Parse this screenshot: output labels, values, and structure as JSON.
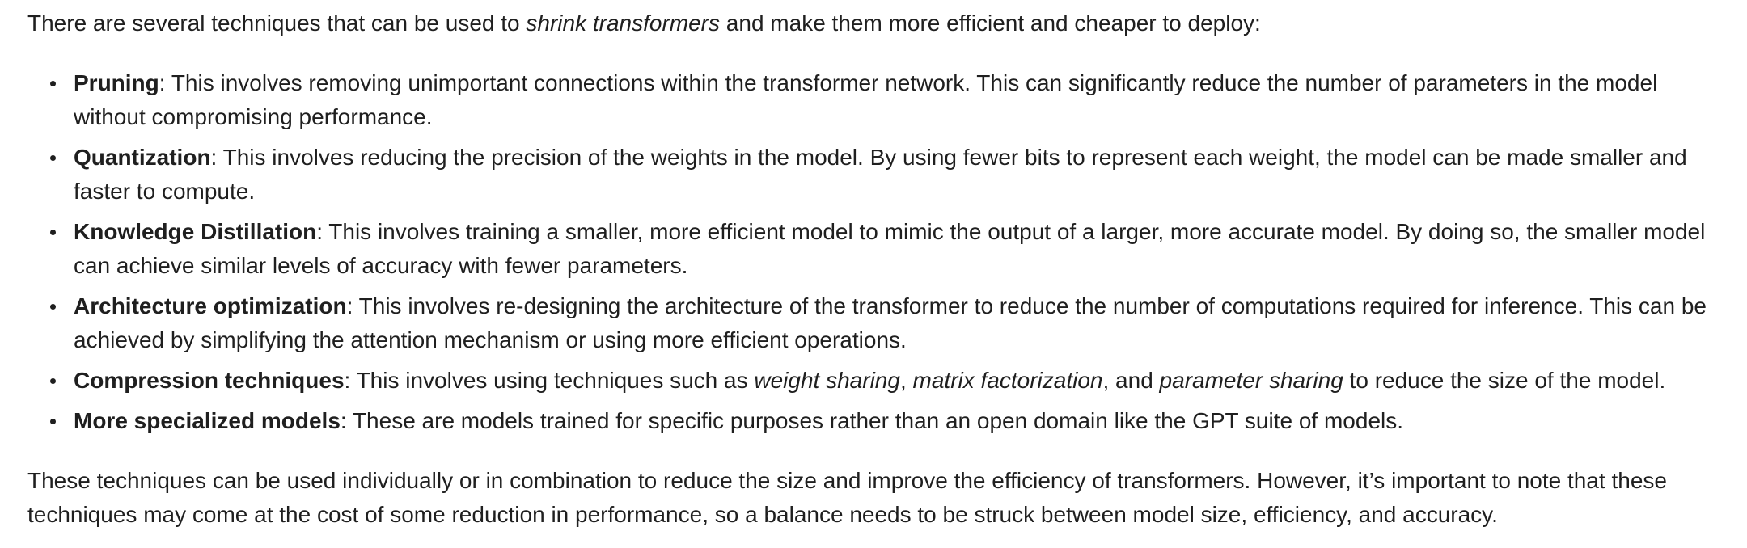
{
  "intro": {
    "before": "There are several techniques that can be used to ",
    "emphasis": "shrink transformers",
    "after": " and make them more efficient and cheaper to deploy:"
  },
  "techniques": [
    {
      "term": "Pruning",
      "text": ": This involves removing unimportant connections within the transformer network. This can significantly reduce the number of parameters in the model without compromising performance."
    },
    {
      "term": "Quantization",
      "text": ": This involves reducing the precision of the weights in the model. By using fewer bits to represent each weight, the model can be made smaller and faster to compute."
    },
    {
      "term": "Knowledge Distillation",
      "text": ": This involves training a smaller, more efficient model to mimic the output of a larger, more accurate model. By doing so, the smaller model can achieve similar levels of accuracy with fewer parameters."
    },
    {
      "term": "Architecture optimization",
      "text": ": This involves re-designing the architecture of the transformer to reduce the number of computations required for inference. This can be achieved by simplifying the attention mechanism or using more efficient operations."
    },
    {
      "term": "Compression techniques",
      "text_1": ": This involves using techniques such as ",
      "em_1": "weight sharing",
      "text_2": ", ",
      "em_2": "matrix factorization",
      "text_3": ", and ",
      "em_3": "parameter sharing",
      "text_4": " to reduce the size of the model."
    },
    {
      "term": "More specialized models",
      "text": ": These are models trained for specific purposes rather than an open domain like the GPT suite of models."
    }
  ],
  "conclusion": "These techniques can be used individually or in combination to reduce the size and improve the efficiency of transformers. However, it’s important to note that these techniques may come at the cost of some reduction in performance, so a balance needs to be struck between model size, efficiency, and accuracy."
}
